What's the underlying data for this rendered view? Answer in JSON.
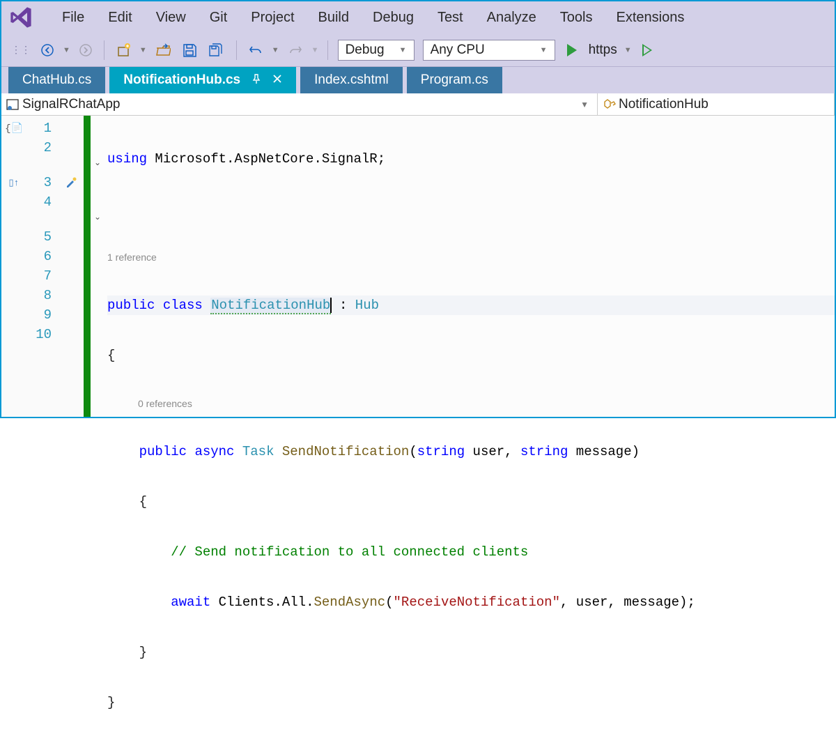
{
  "menu": {
    "items": [
      "File",
      "Edit",
      "View",
      "Git",
      "Project",
      "Build",
      "Debug",
      "Test",
      "Analyze",
      "Tools",
      "Extensions"
    ]
  },
  "toolbar": {
    "config": "Debug",
    "platform": "Any CPU",
    "run_label": "https"
  },
  "tabs": [
    {
      "label": "ChatHub.cs",
      "active": false
    },
    {
      "label": "NotificationHub.cs",
      "active": true,
      "pinned": true,
      "closable": true
    },
    {
      "label": "Index.cshtml",
      "active": false
    },
    {
      "label": "Program.cs",
      "active": false
    }
  ],
  "nav": {
    "project": "SignalRChatApp",
    "type": "NotificationHub"
  },
  "code": {
    "lines": [
      "1",
      "2",
      "3",
      "4",
      "5",
      "6",
      "7",
      "8",
      "9",
      "10"
    ],
    "codelens1": "1 reference",
    "codelens2": "0 references",
    "ns": "Microsoft.AspNetCore.SignalR",
    "class_name": "NotificationHub",
    "base": "Hub",
    "method": "SendNotification",
    "task": "Task",
    "param_t": "string",
    "p1": "user",
    "p2": "message",
    "comment": "// Send notification to all connected clients",
    "await_kw": "await",
    "clients": "Clients",
    "all": "All",
    "send": "SendAsync",
    "arg_str": "\"ReceiveNotification\"",
    "public_kw": "public",
    "class_kw": "class",
    "async_kw": "async",
    "using_kw": "using"
  }
}
